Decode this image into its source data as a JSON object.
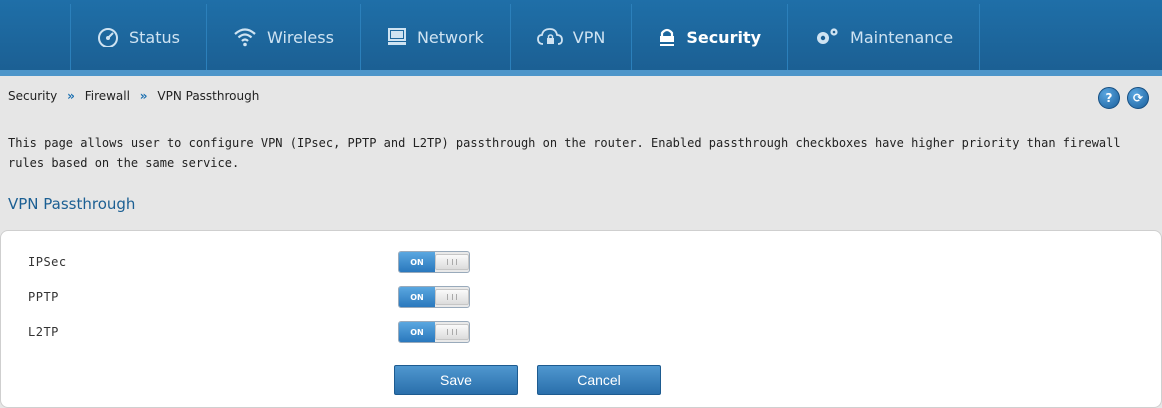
{
  "nav": {
    "items": [
      {
        "label": "Status",
        "icon": "dashboard-icon",
        "active": false
      },
      {
        "label": "Wireless",
        "icon": "wifi-icon",
        "active": false
      },
      {
        "label": "Network",
        "icon": "monitor-icon",
        "active": false
      },
      {
        "label": "VPN",
        "icon": "cloud-lock-icon",
        "active": false
      },
      {
        "label": "Security",
        "icon": "lock-icon",
        "active": true
      },
      {
        "label": "Maintenance",
        "icon": "gears-icon",
        "active": false
      }
    ]
  },
  "breadcrumb": {
    "items": [
      "Security",
      "Firewall",
      "VPN Passthrough"
    ],
    "separator": "»"
  },
  "header_buttons": {
    "help": "?",
    "refresh": "⟳"
  },
  "description": "This page allows user to configure VPN (IPsec, PPTP and L2TP) passthrough on the router. Enabled passthrough checkboxes have higher priority than firewall rules based on the same service.",
  "section": {
    "title": "VPN Passthrough"
  },
  "settings": [
    {
      "label": "IPSec",
      "toggle": "ON"
    },
    {
      "label": "PPTP",
      "toggle": "ON"
    },
    {
      "label": "L2TP",
      "toggle": "ON"
    }
  ],
  "actions": {
    "save": "Save",
    "cancel": "Cancel"
  },
  "colors": {
    "nav_bg": "#1b5f93",
    "accent": "#4d95c9",
    "button": "#2a6fab"
  }
}
